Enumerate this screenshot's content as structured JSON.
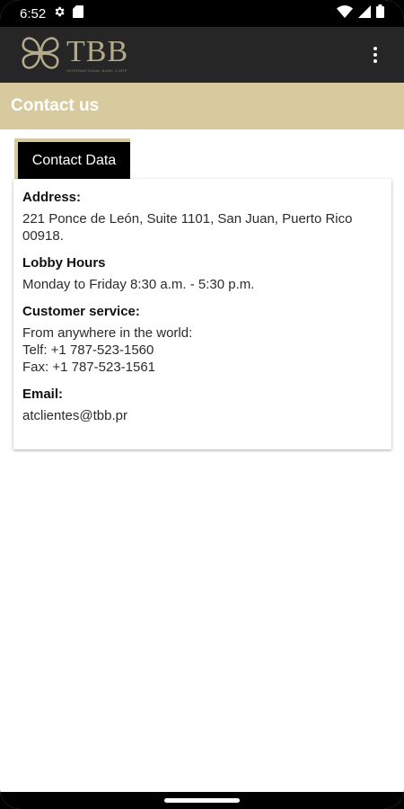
{
  "status_bar": {
    "time": "6:52",
    "left_icons": [
      "gear-icon",
      "sd-card-icon"
    ],
    "right_icons": [
      "wifi-icon",
      "signal-icon",
      "battery-icon"
    ]
  },
  "app_bar": {
    "logo_text": "TBB",
    "logo_subtext": "INTERNATIONAL BANK CORP",
    "menu_icon": "overflow-menu-icon"
  },
  "page": {
    "title": "Contact us"
  },
  "tab": {
    "label": "Contact Data"
  },
  "contact": {
    "address_label": "Address:",
    "address_value": "221 Ponce de León, Suite 1101, San Juan, Puerto Rico 00918.",
    "lobby_label": "Lobby Hours",
    "lobby_value": "Monday to Friday 8:30 a.m. - 5:30 p.m.",
    "service_label": "Customer service:",
    "service_line1": "From anywhere in the world:",
    "service_line2": "Telf: +1 787-523-1560",
    "service_line3": "Fax: +1 787-523-1561",
    "email_label": "Email:",
    "email_value": "atclientes@tbb.pr"
  },
  "colors": {
    "accent_gold": "#d8ca9f",
    "app_bar_bg": "#262626",
    "logo_gold": "#b4ab8c"
  }
}
